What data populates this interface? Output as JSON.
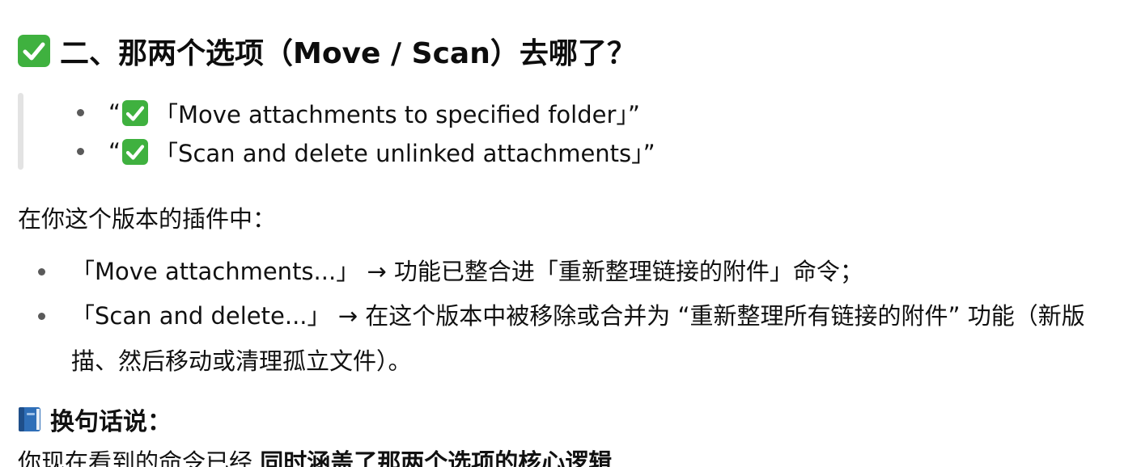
{
  "heading": {
    "text": "二、那两个选项（Move / Scan）去哪了？",
    "icon": "check-mark-emoji"
  },
  "quote": {
    "items": [
      {
        "open": "“",
        "label": "「Move attachments to specified folder」”"
      },
      {
        "open": "“",
        "label": "「Scan and delete unlinked attachments」”"
      }
    ]
  },
  "intro": "在你这个版本的插件中：",
  "list": {
    "items": [
      {
        "line1": "「Move attachments...」 → 功能已整合进「重新整理链接的附件」命令；"
      },
      {
        "line1": "「Scan and delete...」 → 在这个版本中被移除或合并为 “重新整理所有链接的附件” 功能（新版",
        "line2": "描、然后移动或清理孤立文件）。"
      }
    ]
  },
  "subhead": {
    "text": "换句话说：",
    "icon": "blue-book-emoji"
  },
  "last_line": {
    "prefix": "你现在看到的命令已经 ",
    "bold": "同时涵盖了那两个选项的核心逻辑"
  },
  "colors": {
    "check_green": "#3fb13f",
    "book_blue": "#2f6fb8",
    "quote_bar": "#e3e3e3",
    "text": "#111111"
  }
}
